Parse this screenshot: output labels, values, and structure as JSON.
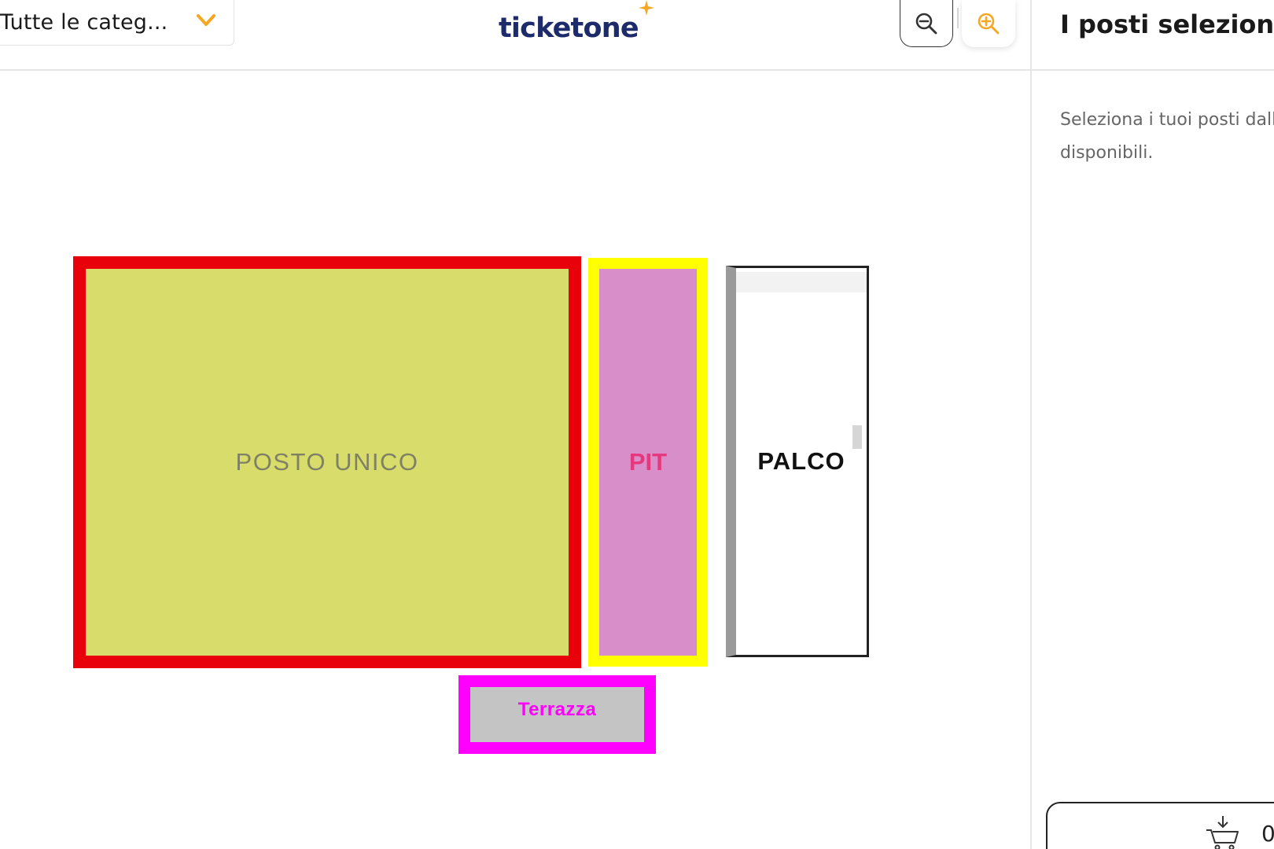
{
  "header": {
    "category_select": {
      "label": "Tutte le categ..."
    },
    "logo": {
      "text": "ticketone"
    },
    "zoom_out_label": "zoom out",
    "zoom_in_label": "zoom in"
  },
  "map": {
    "sectors": [
      {
        "id": "posto-unico",
        "label": "POSTO UNICO"
      },
      {
        "id": "pit",
        "label": "PIT"
      },
      {
        "id": "palco",
        "label": "PALCO"
      },
      {
        "id": "terrazza",
        "label": "Terrazza"
      }
    ]
  },
  "sidebar": {
    "title": "I posti selezionati",
    "hint": "Seleziona i tuoi posti dalle categorie disponibili.",
    "cart": {
      "count": "0"
    }
  },
  "colors": {
    "accent": "#f5a623",
    "logo": "#1d2b6b",
    "posto_unico_border": "#e8000a",
    "posto_unico_fill": "#d8dc6a",
    "pit_border": "#ffff00",
    "pit_fill": "#d88ec8",
    "terrazza_border": "#ff00ff",
    "terrazza_fill": "#c4c4c4"
  },
  "icons": {
    "category_chevron": "chevron-down-icon",
    "zoom_out": "zoom-out-icon",
    "zoom_in": "zoom-in-icon",
    "logo_star": "sparkle-icon",
    "cart": "cart-icon"
  }
}
